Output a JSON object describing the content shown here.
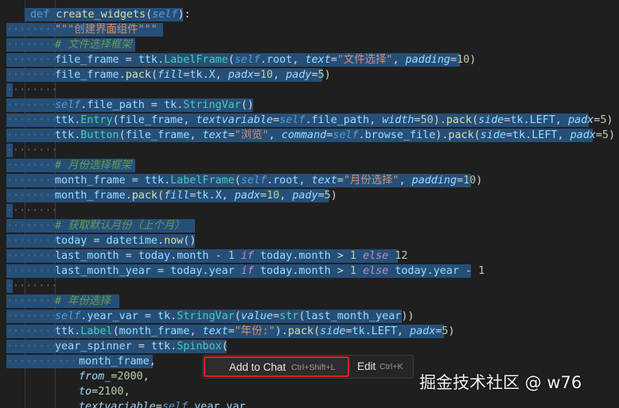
{
  "editor": {
    "lines": [
      {
        "ind": 0,
        "sel": 230,
        "tokens": [
          [
            "kw",
            "def "
          ],
          [
            "fn",
            "create_widgets"
          ],
          [
            "pl",
            "("
          ],
          [
            "self",
            "self"
          ],
          [
            "pl",
            "):"
          ]
        ]
      },
      {
        "ind": 1,
        "sel": 205,
        "tokens": [
          [
            "str",
            "\"\"\"创建界面组件\"\"\""
          ]
        ]
      },
      {
        "ind": 1,
        "sel": 170,
        "tokens": [
          [
            "cmt",
            "# 文件选择框架"
          ]
        ]
      },
      {
        "ind": 1,
        "sel": 578,
        "tokens": [
          [
            "var",
            "file_frame"
          ],
          [
            "pl",
            " = "
          ],
          [
            "var",
            "ttk"
          ],
          [
            "pl",
            "."
          ],
          [
            "cls",
            "LabelFrame"
          ],
          [
            "pl",
            "("
          ],
          [
            "self",
            "self"
          ],
          [
            "pl",
            "."
          ],
          [
            "var",
            "root"
          ],
          [
            "pl",
            ", "
          ],
          [
            "kwarg",
            "text"
          ],
          [
            "pl",
            "="
          ],
          [
            "str",
            "\"文件选择\""
          ],
          [
            "pl",
            ", "
          ],
          [
            "kwarg",
            "padding"
          ],
          [
            "pl",
            "="
          ],
          [
            "num",
            "10"
          ],
          [
            "pl",
            ")"
          ]
        ]
      },
      {
        "ind": 1,
        "sel": 405,
        "tokens": [
          [
            "var",
            "file_frame"
          ],
          [
            "pl",
            "."
          ],
          [
            "fn",
            "pack"
          ],
          [
            "pl",
            "("
          ],
          [
            "kwarg",
            "fill"
          ],
          [
            "pl",
            "="
          ],
          [
            "var",
            "tk"
          ],
          [
            "pl",
            "."
          ],
          [
            "var",
            "X"
          ],
          [
            "pl",
            ", "
          ],
          [
            "kwarg",
            "padx"
          ],
          [
            "pl",
            "="
          ],
          [
            "num",
            "10"
          ],
          [
            "pl",
            ", "
          ],
          [
            "kwarg",
            "pady"
          ],
          [
            "pl",
            "="
          ],
          [
            "num",
            "5"
          ],
          [
            "pl",
            ")"
          ]
        ]
      },
      {
        "ind": 1,
        "sel": 16,
        "tokens": []
      },
      {
        "ind": 1,
        "sel": 318,
        "tokens": [
          [
            "self",
            "self"
          ],
          [
            "pl",
            "."
          ],
          [
            "var",
            "file_path"
          ],
          [
            "pl",
            " = "
          ],
          [
            "var",
            "tk"
          ],
          [
            "pl",
            "."
          ],
          [
            "cls",
            "StringVar"
          ],
          [
            "pl",
            "()"
          ]
        ]
      },
      {
        "ind": 1,
        "sel": 740,
        "tokens": [
          [
            "var",
            "ttk"
          ],
          [
            "pl",
            "."
          ],
          [
            "cls",
            "Entry"
          ],
          [
            "pl",
            "("
          ],
          [
            "var",
            "file_frame"
          ],
          [
            "pl",
            ", "
          ],
          [
            "kwarg",
            "textvariable"
          ],
          [
            "pl",
            "="
          ],
          [
            "self",
            "self"
          ],
          [
            "pl",
            "."
          ],
          [
            "var",
            "file_path"
          ],
          [
            "pl",
            ", "
          ],
          [
            "kwarg",
            "width"
          ],
          [
            "pl",
            "="
          ],
          [
            "num",
            "50"
          ],
          [
            "pl",
            ")."
          ],
          [
            "fn",
            "pack"
          ],
          [
            "pl",
            "("
          ],
          [
            "kwarg",
            "side"
          ],
          [
            "pl",
            "="
          ],
          [
            "var",
            "tk"
          ],
          [
            "pl",
            "."
          ],
          [
            "var",
            "LEFT"
          ],
          [
            "pl",
            ", "
          ],
          [
            "kwarg",
            "padx"
          ],
          [
            "pl",
            "="
          ],
          [
            "num",
            "5"
          ],
          [
            "pl",
            ")"
          ]
        ]
      },
      {
        "ind": 1,
        "sel": 745,
        "tokens": [
          [
            "var",
            "ttk"
          ],
          [
            "pl",
            "."
          ],
          [
            "cls",
            "Button"
          ],
          [
            "pl",
            "("
          ],
          [
            "var",
            "file_frame"
          ],
          [
            "pl",
            ", "
          ],
          [
            "kwarg",
            "text"
          ],
          [
            "pl",
            "="
          ],
          [
            "str",
            "\"浏览\""
          ],
          [
            "pl",
            ", "
          ],
          [
            "kwarg",
            "command"
          ],
          [
            "pl",
            "="
          ],
          [
            "self",
            "self"
          ],
          [
            "pl",
            "."
          ],
          [
            "var",
            "browse_file"
          ],
          [
            "pl",
            ")."
          ],
          [
            "fn",
            "pack"
          ],
          [
            "pl",
            "("
          ],
          [
            "kwarg",
            "side"
          ],
          [
            "pl",
            "="
          ],
          [
            "var",
            "tk"
          ],
          [
            "pl",
            "."
          ],
          [
            "var",
            "LEFT"
          ],
          [
            "pl",
            ", "
          ],
          [
            "kwarg",
            "padx"
          ],
          [
            "pl",
            "="
          ],
          [
            "num",
            "5"
          ],
          [
            "pl",
            ")"
          ]
        ]
      },
      {
        "ind": 1,
        "sel": 16,
        "tokens": []
      },
      {
        "ind": 1,
        "sel": 170,
        "tokens": [
          [
            "cmt",
            "# 月份选择框架"
          ]
        ]
      },
      {
        "ind": 1,
        "sel": 592,
        "tokens": [
          [
            "var",
            "month_frame"
          ],
          [
            "pl",
            " = "
          ],
          [
            "var",
            "ttk"
          ],
          [
            "pl",
            "."
          ],
          [
            "cls",
            "LabelFrame"
          ],
          [
            "pl",
            "("
          ],
          [
            "self",
            "self"
          ],
          [
            "pl",
            "."
          ],
          [
            "var",
            "root"
          ],
          [
            "pl",
            ", "
          ],
          [
            "kwarg",
            "text"
          ],
          [
            "pl",
            "="
          ],
          [
            "str",
            "\"月份选择\""
          ],
          [
            "pl",
            ", "
          ],
          [
            "kwarg",
            "padding"
          ],
          [
            "pl",
            "="
          ],
          [
            "num",
            "10"
          ],
          [
            "pl",
            ")"
          ]
        ]
      },
      {
        "ind": 1,
        "sel": 413,
        "tokens": [
          [
            "var",
            "month_frame"
          ],
          [
            "pl",
            "."
          ],
          [
            "fn",
            "pack"
          ],
          [
            "pl",
            "("
          ],
          [
            "kwarg",
            "fill"
          ],
          [
            "pl",
            "="
          ],
          [
            "var",
            "tk"
          ],
          [
            "pl",
            "."
          ],
          [
            "var",
            "X"
          ],
          [
            "pl",
            ", "
          ],
          [
            "kwarg",
            "padx"
          ],
          [
            "pl",
            "="
          ],
          [
            "num",
            "10"
          ],
          [
            "pl",
            ", "
          ],
          [
            "kwarg",
            "pady"
          ],
          [
            "pl",
            "="
          ],
          [
            "num",
            "5"
          ],
          [
            "pl",
            ")"
          ]
        ]
      },
      {
        "ind": 1,
        "sel": 16,
        "tokens": []
      },
      {
        "ind": 1,
        "sel": 245,
        "tokens": [
          [
            "cmt",
            "# 获取默认月份（上个月）"
          ]
        ]
      },
      {
        "ind": 1,
        "sel": 245,
        "tokens": [
          [
            "var",
            "today"
          ],
          [
            "pl",
            " = "
          ],
          [
            "var",
            "datetime"
          ],
          [
            "pl",
            "."
          ],
          [
            "fn",
            "now"
          ],
          [
            "pl",
            "()"
          ]
        ]
      },
      {
        "ind": 1,
        "sel": 500,
        "tokens": [
          [
            "var",
            "last_month"
          ],
          [
            "pl",
            " = "
          ],
          [
            "var",
            "today"
          ],
          [
            "pl",
            "."
          ],
          [
            "var",
            "month"
          ],
          [
            "pl",
            " - "
          ],
          [
            "num",
            "1"
          ],
          [
            "pl",
            " "
          ],
          [
            "ctl",
            "if"
          ],
          [
            "pl",
            " "
          ],
          [
            "var",
            "today"
          ],
          [
            "pl",
            "."
          ],
          [
            "var",
            "month"
          ],
          [
            "pl",
            " > "
          ],
          [
            "num",
            "1"
          ],
          [
            "pl",
            " "
          ],
          [
            "ctl",
            "else"
          ],
          [
            "pl",
            " "
          ],
          [
            "num",
            "12"
          ]
        ]
      },
      {
        "ind": 1,
        "sel": 592,
        "tokens": [
          [
            "var",
            "last_month_year"
          ],
          [
            "pl",
            " = "
          ],
          [
            "var",
            "today"
          ],
          [
            "pl",
            "."
          ],
          [
            "var",
            "year"
          ],
          [
            "pl",
            " "
          ],
          [
            "ctl",
            "if"
          ],
          [
            "pl",
            " "
          ],
          [
            "var",
            "today"
          ],
          [
            "pl",
            "."
          ],
          [
            "var",
            "month"
          ],
          [
            "pl",
            " > "
          ],
          [
            "num",
            "1"
          ],
          [
            "pl",
            " "
          ],
          [
            "ctl",
            "else"
          ],
          [
            "pl",
            " "
          ],
          [
            "var",
            "today"
          ],
          [
            "pl",
            "."
          ],
          [
            "var",
            "year"
          ],
          [
            "pl",
            " - "
          ],
          [
            "num",
            "1"
          ]
        ]
      },
      {
        "ind": 1,
        "sel": 16,
        "tokens": []
      },
      {
        "ind": 1,
        "sel": 150,
        "tokens": [
          [
            "cmt",
            "# 年份选择"
          ]
        ]
      },
      {
        "ind": 1,
        "sel": 505,
        "tokens": [
          [
            "self",
            "self"
          ],
          [
            "pl",
            "."
          ],
          [
            "var",
            "year_var"
          ],
          [
            "pl",
            " = "
          ],
          [
            "var",
            "tk"
          ],
          [
            "pl",
            "."
          ],
          [
            "cls",
            "StringVar"
          ],
          [
            "pl",
            "("
          ],
          [
            "kwarg",
            "value"
          ],
          [
            "pl",
            "="
          ],
          [
            "cls",
            "str"
          ],
          [
            "pl",
            "("
          ],
          [
            "var",
            "last_month_year"
          ],
          [
            "pl",
            "))"
          ]
        ]
      },
      {
        "ind": 1,
        "sel": 558,
        "tokens": [
          [
            "var",
            "ttk"
          ],
          [
            "pl",
            "."
          ],
          [
            "cls",
            "Label"
          ],
          [
            "pl",
            "("
          ],
          [
            "var",
            "month_frame"
          ],
          [
            "pl",
            ", "
          ],
          [
            "kwarg",
            "text"
          ],
          [
            "pl",
            "="
          ],
          [
            "str",
            "\"年份:\""
          ],
          [
            "pl",
            ")."
          ],
          [
            "fn",
            "pack"
          ],
          [
            "pl",
            "("
          ],
          [
            "kwarg",
            "side"
          ],
          [
            "pl",
            "="
          ],
          [
            "var",
            "tk"
          ],
          [
            "pl",
            "."
          ],
          [
            "var",
            "LEFT"
          ],
          [
            "pl",
            ", "
          ],
          [
            "kwarg",
            "padx"
          ],
          [
            "pl",
            "="
          ],
          [
            "num",
            "5"
          ],
          [
            "pl",
            ")"
          ]
        ]
      },
      {
        "ind": 1,
        "sel": 285,
        "tokens": [
          [
            "var",
            "year_spinner"
          ],
          [
            "pl",
            " = "
          ],
          [
            "var",
            "ttk"
          ],
          [
            "pl",
            "."
          ],
          [
            "cls",
            "Spinbox"
          ],
          [
            "pl",
            "("
          ]
        ]
      },
      {
        "ind": 2,
        "sel": 192,
        "tokens": [
          [
            "var",
            "month_frame"
          ],
          [
            "pl",
            ","
          ]
        ]
      },
      {
        "ind": 2,
        "sel": 0,
        "tokens": [
          [
            "kwarg",
            "from_"
          ],
          [
            "pl",
            "="
          ],
          [
            "num",
            "2000"
          ],
          [
            "pl",
            ","
          ]
        ]
      },
      {
        "ind": 2,
        "sel": 0,
        "tokens": [
          [
            "kwarg",
            "to"
          ],
          [
            "pl",
            "="
          ],
          [
            "num",
            "2100"
          ],
          [
            "pl",
            ","
          ]
        ]
      },
      {
        "ind": 2,
        "sel": 0,
        "tokens": [
          [
            "kwarg",
            "textvariable"
          ],
          [
            "pl",
            "="
          ],
          [
            "self",
            "self"
          ],
          [
            "pl",
            "."
          ],
          [
            "var",
            "year_var"
          ],
          [
            "pl",
            ","
          ]
        ]
      }
    ]
  },
  "context_widget": {
    "add_chat_label": "Add to Chat",
    "add_chat_shortcut": "Ctrl+Shift+L",
    "edit_label": "Edit",
    "edit_shortcut": "Ctrl+K"
  },
  "watermark": "掘金技术社区 @ w76",
  "colors": {
    "background": "#1f1f1f",
    "selection": "#264f78",
    "highlight_box": "#e0201b"
  }
}
